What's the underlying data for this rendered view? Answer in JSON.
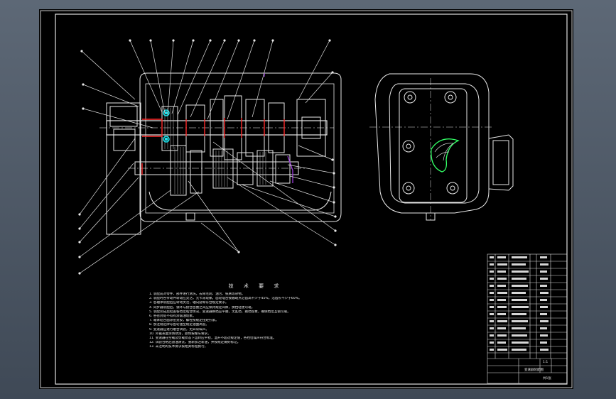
{
  "notes_title": "技 术 要 求",
  "notes": [
    "1. 装配前对零件、部件进行清洗，去除毛刺、油污、铁屑等杂物。",
    "2. 装配时各传动件转动应灵活，无卡滞现象，齿轮啮合接触斑点沿齿高不少于45%，沿齿长不少于60%。",
    "3. 各轴承装配后应转动灵活，轴向游隙符合规定要求。",
    "4. 同步器装配后，锁环与接合齿圈之间应保持规定间隙，换挡轻便可靠。",
    "5. 装配完成后检查各挡位啮合情况，变速器换挡应平顺，无乱挡、跳挡现象，确保档位互锁可靠。",
    "6. 各密封处不得有渗漏油现象。",
    "7. 箱体结合面涂密封胶，螺栓按规定扭矩拧紧。",
    "8. 加注规定牌号齿轮油至规定油面高度。",
    "9. 变速器应进行磨合试验，无异常噪声。",
    "10. 外露表面涂防锈漆，颜色按整车要求。",
    "11. 变速器在空载及负载状态下运转应平稳，温升不超过规定值，各挡位噪声符合标准。",
    "12. 试验合格后放油清洗，重新加注新油，并按规定做好标记。",
    "13. 未注明的技术要求按相关标准执行。"
  ],
  "title_block": {
    "drawing_name": "变速器装配图",
    "scale": "1:1",
    "sheet": "共1张"
  }
}
